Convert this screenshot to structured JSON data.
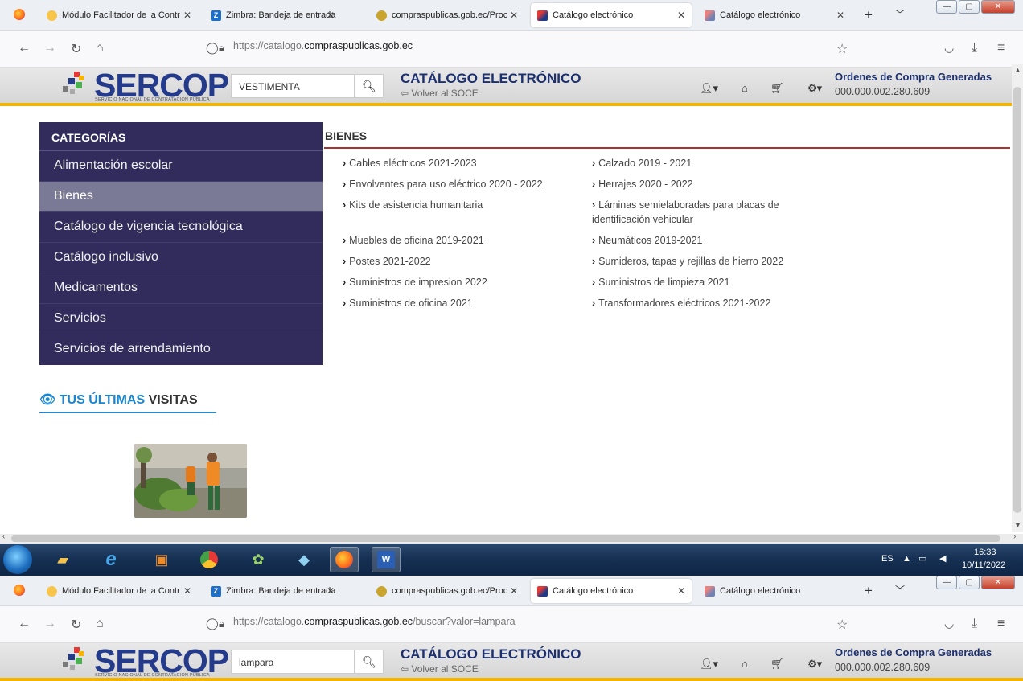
{
  "top": {
    "tabs": [
      {
        "label": "Módulo Facilitador de la Contr",
        "favicon": "quipux-icon"
      },
      {
        "label": "Zimbra: Bandeja de entrada",
        "favicon": "zimbra-icon"
      },
      {
        "label": "compraspublicas.gob.ec/Proc",
        "favicon": "shield-icon"
      },
      {
        "label": "Catálogo electrónico",
        "favicon": "sercop-icon"
      },
      {
        "label": "Catálogo electrónico",
        "favicon": "sercop-icon"
      }
    ],
    "url_host": "https://catalogo.",
    "url_domain": "compraspublicas.gob.ec",
    "url_path": "",
    "search_value": "VESTIMENTA"
  },
  "bottom": {
    "tabs": [
      {
        "label": "Módulo Facilitador de la Contr",
        "favicon": "quipux-icon"
      },
      {
        "label": "Zimbra: Bandeja de entrada",
        "favicon": "zimbra-icon"
      },
      {
        "label": "compraspublicas.gob.ec/Proc",
        "favicon": "shield-icon"
      },
      {
        "label": "Catálogo electrónico",
        "favicon": "sercop-icon"
      },
      {
        "label": "Catálogo electrónico",
        "favicon": "sercop-icon"
      }
    ],
    "url_host": "https://catalogo.",
    "url_domain": "compraspublicas.gob.ec",
    "url_path": "/buscar?valor=lampara",
    "search_value": "lampara"
  },
  "header": {
    "logo": "SERCOP",
    "logo_sub": "SERVICIO NACIONAL DE CONTRATACIÓN PÚBLICA",
    "catalog_title": "CATÁLOGO ELECTRÓNICO",
    "back_link": "Volver al SOCE",
    "orders_title": "Ordenes de Compra Generadas",
    "orders_count": "000.000.002.280.609"
  },
  "sidebar": {
    "title": "CATEGORÍAS",
    "items": [
      "Alimentación escolar",
      "Bienes",
      "Catálogo de vigencia tecnológica",
      "Catálogo inclusivo",
      "Medicamentos",
      "Servicios",
      "Servicios de arrendamiento"
    ],
    "selected_index": 1
  },
  "visits": {
    "title_highlight": "TUS ÚLTIMAS",
    "title_rest": "VISITAS"
  },
  "bienes": {
    "title": "BIENES",
    "col1": [
      "Cables eléctricos 2021-2023",
      "Envolventes para uso eléctrico 2020 - 2022",
      "Kits de asistencia humanitaria",
      "Muebles de oficina 2019-2021",
      "Postes 2021-2022",
      "Suministros de impresion 2022",
      "Suministros de oficina 2021"
    ],
    "col2": [
      "Calzado 2019 - 2021",
      "Herrajes 2020 - 2022",
      "Láminas semielaboradas para placas de identificación vehicular",
      "Neumáticos 2019-2021",
      "Sumideros, tapas y rejillas de hierro 2022",
      "Suministros de limpieza 2021",
      "Transformadores eléctricos 2021-2022"
    ]
  },
  "taskbar": {
    "lang": "ES",
    "time": "16:33",
    "date": "10/11/2022"
  },
  "colors": {
    "sidebar_bg": "#312c5c",
    "sidebar_selected": "#7b7a96",
    "brand_blue": "#243a8a",
    "accent_gold": "#f2b400",
    "bienes_rule": "#a93434"
  }
}
